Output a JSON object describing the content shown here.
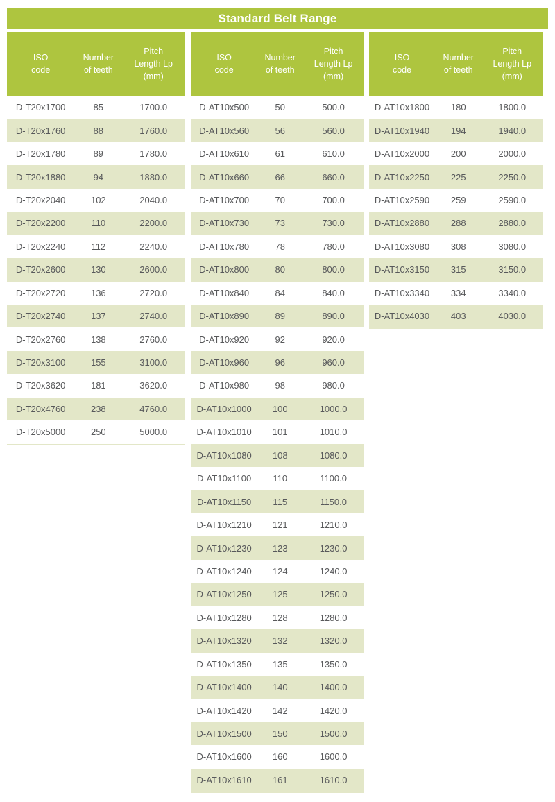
{
  "title": "Standard Belt Range",
  "colors": {
    "header_green": "#aec53f",
    "row_stripe": "#e3e7c8",
    "text_gray": "#58595b",
    "header_text": "#ffffff",
    "page_background": "#ffffff"
  },
  "columns": [
    {
      "headers": {
        "iso": "ISO\ncode",
        "iso_line1": "ISO",
        "iso_line2": "code",
        "teeth_line1": "Number",
        "teeth_line2": "of teeth",
        "pitch_line1": "Pitch",
        "pitch_line2": "Length Lp",
        "pitch_line3": "(mm)"
      },
      "rows": [
        {
          "iso": "D-T20x1700",
          "teeth": "85",
          "pitch": "1700.0"
        },
        {
          "iso": "D-T20x1760",
          "teeth": "88",
          "pitch": "1760.0"
        },
        {
          "iso": "D-T20x1780",
          "teeth": "89",
          "pitch": "1780.0"
        },
        {
          "iso": "D-T20x1880",
          "teeth": "94",
          "pitch": "1880.0"
        },
        {
          "iso": "D-T20x2040",
          "teeth": "102",
          "pitch": "2040.0"
        },
        {
          "iso": "D-T20x2200",
          "teeth": "110",
          "pitch": "2200.0"
        },
        {
          "iso": "D-T20x2240",
          "teeth": "112",
          "pitch": "2240.0"
        },
        {
          "iso": "D-T20x2600",
          "teeth": "130",
          "pitch": "2600.0"
        },
        {
          "iso": "D-T20x2720",
          "teeth": "136",
          "pitch": "2720.0"
        },
        {
          "iso": "D-T20x2740",
          "teeth": "137",
          "pitch": "2740.0"
        },
        {
          "iso": "D-T20x2760",
          "teeth": "138",
          "pitch": "2760.0"
        },
        {
          "iso": "D-T20x3100",
          "teeth": "155",
          "pitch": "3100.0"
        },
        {
          "iso": "D-T20x3620",
          "teeth": "181",
          "pitch": "3620.0"
        },
        {
          "iso": "D-T20x4760",
          "teeth": "238",
          "pitch": "4760.0"
        },
        {
          "iso": "D-T20x5000",
          "teeth": "250",
          "pitch": "5000.0"
        }
      ]
    },
    {
      "headers": {
        "iso_line1": "ISO",
        "iso_line2": "code",
        "teeth_line1": "Number",
        "teeth_line2": "of teeth",
        "pitch_line1": "Pitch",
        "pitch_line2": "Length Lp",
        "pitch_line3": "(mm)"
      },
      "rows": [
        {
          "iso": "D-AT10x500",
          "teeth": "50",
          "pitch": "500.0"
        },
        {
          "iso": "D-AT10x560",
          "teeth": "56",
          "pitch": "560.0"
        },
        {
          "iso": "D-AT10x610",
          "teeth": "61",
          "pitch": "610.0"
        },
        {
          "iso": "D-AT10x660",
          "teeth": "66",
          "pitch": "660.0"
        },
        {
          "iso": "D-AT10x700",
          "teeth": "70",
          "pitch": "700.0"
        },
        {
          "iso": "D-AT10x730",
          "teeth": "73",
          "pitch": "730.0"
        },
        {
          "iso": "D-AT10x780",
          "teeth": "78",
          "pitch": "780.0"
        },
        {
          "iso": "D-AT10x800",
          "teeth": "80",
          "pitch": "800.0"
        },
        {
          "iso": "D-AT10x840",
          "teeth": "84",
          "pitch": "840.0"
        },
        {
          "iso": "D-AT10x890",
          "teeth": "89",
          "pitch": "890.0"
        },
        {
          "iso": "D-AT10x920",
          "teeth": "92",
          "pitch": "920.0"
        },
        {
          "iso": "D-AT10x960",
          "teeth": "96",
          "pitch": "960.0"
        },
        {
          "iso": "D-AT10x980",
          "teeth": "98",
          "pitch": "980.0"
        },
        {
          "iso": "D-AT10x1000",
          "teeth": "100",
          "pitch": "1000.0"
        },
        {
          "iso": "D-AT10x1010",
          "teeth": "101",
          "pitch": "1010.0"
        },
        {
          "iso": "D-AT10x1080",
          "teeth": "108",
          "pitch": "1080.0"
        },
        {
          "iso": "D-AT10x1100",
          "teeth": "110",
          "pitch": "1100.0"
        },
        {
          "iso": "D-AT10x1150",
          "teeth": "115",
          "pitch": "1150.0"
        },
        {
          "iso": "D-AT10x1210",
          "teeth": "121",
          "pitch": "1210.0"
        },
        {
          "iso": "D-AT10x1230",
          "teeth": "123",
          "pitch": "1230.0"
        },
        {
          "iso": "D-AT10x1240",
          "teeth": "124",
          "pitch": "1240.0"
        },
        {
          "iso": "D-AT10x1250",
          "teeth": "125",
          "pitch": "1250.0"
        },
        {
          "iso": "D-AT10x1280",
          "teeth": "128",
          "pitch": "1280.0"
        },
        {
          "iso": "D-AT10x1320",
          "teeth": "132",
          "pitch": "1320.0"
        },
        {
          "iso": "D-AT10x1350",
          "teeth": "135",
          "pitch": "1350.0"
        },
        {
          "iso": "D-AT10x1400",
          "teeth": "140",
          "pitch": "1400.0"
        },
        {
          "iso": "D-AT10x1420",
          "teeth": "142",
          "pitch": "1420.0"
        },
        {
          "iso": "D-AT10x1500",
          "teeth": "150",
          "pitch": "1500.0"
        },
        {
          "iso": "D-AT10x1600",
          "teeth": "160",
          "pitch": "1600.0"
        },
        {
          "iso": "D-AT10x1610",
          "teeth": "161",
          "pitch": "1610.0"
        }
      ]
    },
    {
      "headers": {
        "iso_line1": "ISO",
        "iso_line2": "code",
        "teeth_line1": "Number",
        "teeth_line2": "of teeth",
        "pitch_line1": "Pitch",
        "pitch_line2": "Length Lp",
        "pitch_line3": "(mm)"
      },
      "rows": [
        {
          "iso": "D-AT10x1800",
          "teeth": "180",
          "pitch": "1800.0"
        },
        {
          "iso": "D-AT10x1940",
          "teeth": "194",
          "pitch": "1940.0"
        },
        {
          "iso": "D-AT10x2000",
          "teeth": "200",
          "pitch": "2000.0"
        },
        {
          "iso": "D-AT10x2250",
          "teeth": "225",
          "pitch": "2250.0"
        },
        {
          "iso": "D-AT10x2590",
          "teeth": "259",
          "pitch": "2590.0"
        },
        {
          "iso": "D-AT10x2880",
          "teeth": "288",
          "pitch": "2880.0"
        },
        {
          "iso": "D-AT10x3080",
          "teeth": "308",
          "pitch": "3080.0"
        },
        {
          "iso": "D-AT10x3150",
          "teeth": "315",
          "pitch": "3150.0"
        },
        {
          "iso": "D-AT10x3340",
          "teeth": "334",
          "pitch": "3340.0"
        },
        {
          "iso": "D-AT10x4030",
          "teeth": "403",
          "pitch": "4030.0"
        }
      ]
    }
  ]
}
